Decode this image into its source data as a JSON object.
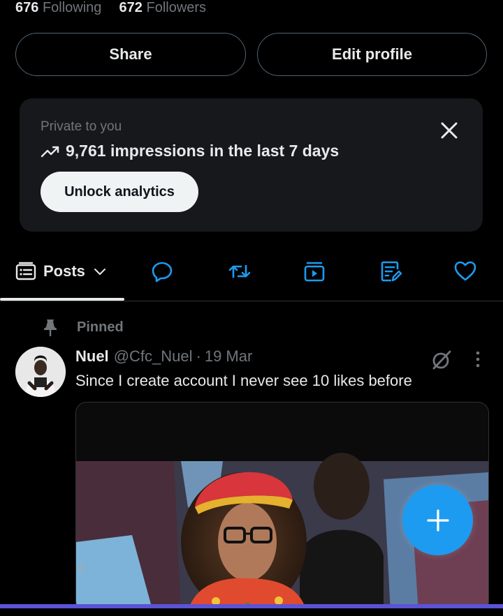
{
  "profile": {
    "following_count": "676",
    "following_label": "Following",
    "followers_count": "672",
    "followers_label": "Followers"
  },
  "actions": {
    "share_label": "Share",
    "edit_label": "Edit profile"
  },
  "analytics_card": {
    "private_label": "Private to you",
    "impressions_text": "9,761 impressions in the last 7 days",
    "unlock_label": "Unlock analytics",
    "close_icon": "close-icon",
    "trend_icon": "trending-up-icon"
  },
  "tabs": {
    "active_label": "Posts",
    "items": [
      "posts",
      "replies",
      "reposts",
      "media",
      "articles",
      "likes"
    ],
    "icons": [
      "posts-icon",
      "reply-icon",
      "repost-icon",
      "video-icon",
      "article-icon",
      "heart-icon"
    ]
  },
  "post": {
    "pinned_label": "Pinned",
    "author_name": "Nuel",
    "handle": "@Cfc_Nuel",
    "separator": "·",
    "date": "19 Mar",
    "text": "Since I create account I never see 10 likes before"
  },
  "colors": {
    "background": "#000000",
    "accent": "#1d9bf0",
    "muted": "#71767b",
    "card": "#16181c"
  }
}
